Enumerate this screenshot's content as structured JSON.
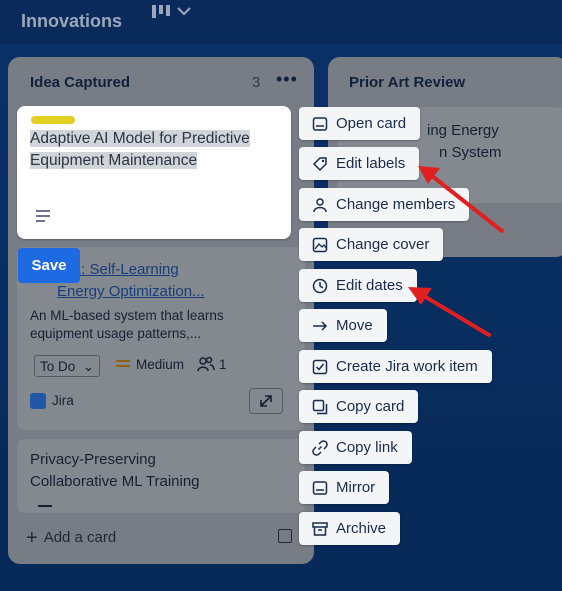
{
  "board": {
    "title": "Innovations"
  },
  "list1": {
    "title": "Idea Captured",
    "count": "3",
    "add_card": "Add a card"
  },
  "editing_card": {
    "text": "Adaptive AI Model for Predictive Equipment Maintenance",
    "label_color": "#e2cf22",
    "save_label": "Save"
  },
  "card2": {
    "title_line1": "R-1: Self-Learning",
    "title_line2": "Energy Optimization...",
    "desc_line1": "An ML-based system that learns",
    "desc_line2": "equipment usage patterns,...",
    "status": "To Do",
    "priority": "Medium",
    "members": "1",
    "jira": "Jira"
  },
  "card3": {
    "line1": "Privacy-Preserving",
    "line2": "Collaborative ML Training"
  },
  "list2": {
    "title": "Prior Art Review",
    "card_line1": "ing Energy",
    "card_line2": "n System"
  },
  "menu": [
    {
      "label": "Open card",
      "icon": "card-icon"
    },
    {
      "label": "Edit labels",
      "icon": "tag-icon"
    },
    {
      "label": "Change members",
      "icon": "person-icon"
    },
    {
      "label": "Change cover",
      "icon": "image-icon"
    },
    {
      "label": "Edit dates",
      "icon": "clock-icon"
    },
    {
      "label": "Move",
      "icon": "arrow-right-icon"
    },
    {
      "label": "Create Jira work item",
      "icon": "checkbox-icon"
    },
    {
      "label": "Copy card",
      "icon": "copy-icon"
    },
    {
      "label": "Copy link",
      "icon": "link-icon"
    },
    {
      "label": "Mirror",
      "icon": "mirror-icon"
    },
    {
      "label": "Archive",
      "icon": "archive-icon"
    }
  ],
  "colors": {
    "accent": "#1d6ae3",
    "annotation_arrow": "#e02020"
  }
}
